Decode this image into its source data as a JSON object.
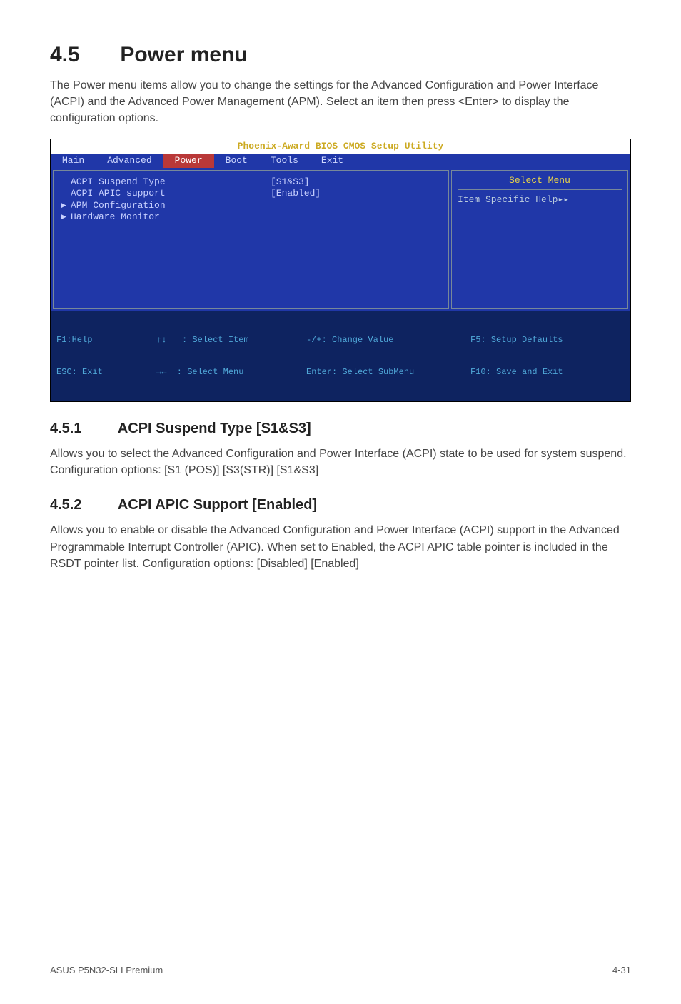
{
  "section": {
    "number": "4.5",
    "title": "Power menu",
    "intro": "The Power menu items allow you to change the settings for the Advanced Configuration and Power Interface (ACPI) and the Advanced Power Management (APM). Select an item then press <Enter> to display the configuration options."
  },
  "bios": {
    "title": "Phoenix-Award BIOS CMOS Setup Utility",
    "menubar": [
      "Main",
      "Advanced",
      "Power",
      "Boot",
      "Tools",
      "Exit"
    ],
    "active_menu_index": 2,
    "left_rows": [
      {
        "arrow": " ",
        "label": "ACPI Suspend Type",
        "value": "[S1&S3]"
      },
      {
        "arrow": " ",
        "label": "ACPI APIC support",
        "value": "[Enabled]"
      },
      {
        "arrow": "▶",
        "label": "APM Configuration",
        "value": ""
      },
      {
        "arrow": "▶",
        "label": "Hardware Monitor",
        "value": ""
      }
    ],
    "right": {
      "select_menu": "Select Menu",
      "help": "Item Specific Help▸▸"
    },
    "footer": {
      "c1a": "F1:Help",
      "c1b": "ESC: Exit",
      "c2a": "↑↓   : Select Item",
      "c2b": "→←  : Select Menu",
      "c3a": "-/+: Change Value",
      "c3b": "Enter: Select SubMenu",
      "c4a": "F5: Setup Defaults",
      "c4b": "F10: Save and Exit"
    }
  },
  "sub1": {
    "number": "4.5.1",
    "title": "ACPI Suspend Type [S1&S3]",
    "body": "Allows you to select the Advanced Configuration and Power Interface (ACPI) state to be used for system suspend. Configuration options: [S1 (POS)] [S3(STR)] [S1&S3]"
  },
  "sub2": {
    "number": "4.5.2",
    "title": "ACPI APIC Support [Enabled]",
    "body": "Allows you to enable or disable the Advanced Configuration and Power Interface (ACPI) support in the Advanced Programmable Interrupt Controller (APIC). When set to Enabled, the ACPI APIC table pointer is included in the RSDT pointer list. Configuration options: [Disabled] [Enabled]"
  },
  "footer": {
    "product": "ASUS P5N32-SLI Premium",
    "page": "4-31"
  }
}
